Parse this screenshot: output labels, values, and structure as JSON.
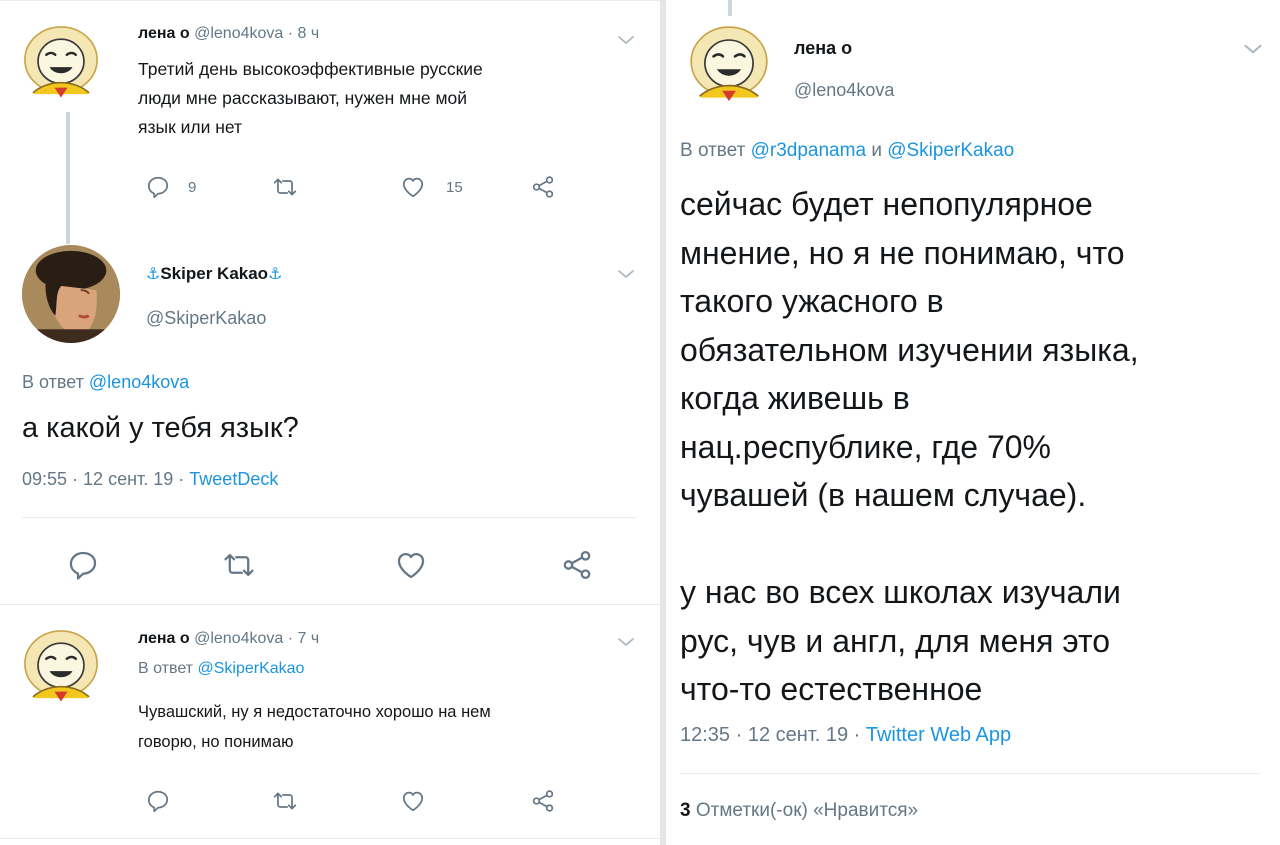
{
  "left": {
    "tweet1": {
      "display_name": "лена о",
      "handle": "@leno4kova",
      "sep": "·",
      "time": "8 ч",
      "text_lines": [
        "Третий день высокоэффективные русские",
        "люди мне рассказывают, нужен мне мой",
        "язык или нет"
      ],
      "reply_count": "9",
      "like_count": "15"
    },
    "tweet2": {
      "display_name": "Skiper Kakao",
      "anchor_emoji": "⚓",
      "handle": "@SkiperKakao",
      "reply_prefix": "В ответ",
      "reply_to": "@leno4kova",
      "text": "а какой у тебя язык?",
      "meta_time": "09:55 · 12 сент. 19 ·",
      "meta_source": "TweetDeck"
    },
    "tweet3": {
      "display_name": "лена о",
      "handle": "@leno4kova",
      "sep": "·",
      "time": "7 ч",
      "reply_prefix": "В ответ",
      "reply_to": "@SkiperKakao",
      "text_lines": [
        "Чувашский, ну я недостаточно хорошо на нем",
        "говорю, но понимаю"
      ]
    }
  },
  "right": {
    "display_name": "лена о",
    "handle": "@leno4kova",
    "reply_prefix": "В ответ",
    "reply_to_1": "@r3dpanama",
    "reply_and": "и",
    "reply_to_2": "@SkiperKakao",
    "text_lines": [
      "сейчас будет непопулярное",
      "мнение, но я не понимаю, что",
      "такого ужасного в",
      "обязательном изучении языка,",
      "когда живешь в",
      "нац.республике, где 70%",
      "чувашей (в нашем случае).",
      "у нас во всех школах изучали",
      "рус, чув и англ, для меня это",
      "что-то естественное"
    ],
    "meta_time": "12:35 · 12 сент. 19 ·",
    "meta_source": "Twitter Web App",
    "likes_count": "3",
    "likes_label": "Отметки(-ок) «Нравится»"
  },
  "colors": {
    "accent": "#1b95e0",
    "muted": "#657786",
    "text": "#14171a",
    "divider": "#e6ecf0"
  },
  "icons": [
    "chevron-down-icon",
    "reply-icon",
    "retweet-icon",
    "like-icon",
    "share-icon",
    "anchor-icon"
  ]
}
